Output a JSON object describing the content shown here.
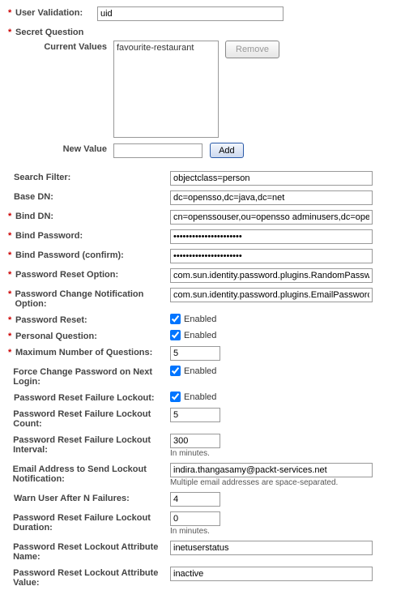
{
  "userValidation": {
    "label": "User Validation:",
    "value": "uid"
  },
  "secretQuestion": {
    "heading": "Secret Question",
    "currentValuesLabel": "Current Values",
    "currentValue": "favourite-restaurant",
    "removeLabel": "Remove",
    "newValueLabel": "New Value",
    "newValue": "",
    "addLabel": "Add"
  },
  "fields": {
    "searchFilter": {
      "label": "Search Filter:",
      "value": "objectclass=person",
      "req": false
    },
    "baseDN": {
      "label": "Base DN:",
      "value": "dc=opensso,dc=java,dc=net",
      "req": false
    },
    "bindDN": {
      "label": "Bind DN:",
      "value": "cn=openssouser,ou=opensso adminusers,dc=opensso,dc=java,dc=net",
      "req": true
    },
    "bindPassword": {
      "label": "Bind Password:",
      "value": "••••••••••••••••••••••",
      "req": true
    },
    "bindPasswordC": {
      "label": "Bind Password (confirm):",
      "value": "••••••••••••••••••••••",
      "req": true
    },
    "pwResetOpt": {
      "label": "Password Reset Option:",
      "value": "com.sun.identity.password.plugins.RandomPasswordGenerator",
      "req": true
    },
    "pwChangeNotif": {
      "label": "Password Change Notification Option:",
      "value": "com.sun.identity.password.plugins.EmailPassword",
      "req": true
    },
    "pwReset": {
      "label": "Password Reset:",
      "checked": true,
      "chkLabel": "Enabled",
      "req": true
    },
    "personalQ": {
      "label": "Personal Question:",
      "checked": true,
      "chkLabel": "Enabled",
      "req": true
    },
    "maxQ": {
      "label": "Maximum Number of Questions:",
      "value": "5",
      "req": true
    },
    "forceChange": {
      "label": "Force Change Password on Next Login:",
      "checked": true,
      "chkLabel": "Enabled",
      "req": false
    },
    "failLockout": {
      "label": "Password Reset Failure Lockout:",
      "checked": true,
      "chkLabel": "Enabled",
      "req": false
    },
    "failCount": {
      "label": "Password Reset Failure Lockout Count:",
      "value": "5",
      "req": false
    },
    "failInterval": {
      "label": "Password Reset Failure Lockout Interval:",
      "value": "300",
      "hint": "In minutes.",
      "req": false
    },
    "lockEmail": {
      "label": "Email Address to Send Lockout Notification:",
      "value": "indira.thangasamy@packt-services.net",
      "hint": "Multiple email addresses are space-separated.",
      "req": false
    },
    "warnAfterN": {
      "label": "Warn User After N Failures:",
      "value": "4",
      "req": false
    },
    "failDuration": {
      "label": "Password Reset Failure Lockout Duration:",
      "value": "0",
      "hint": "In minutes.",
      "req": false
    },
    "lockAttrName": {
      "label": "Password Reset Lockout Attribute Name:",
      "value": "inetuserstatus",
      "req": false
    },
    "lockAttrValue": {
      "label": "Password Reset Lockout Attribute Value:",
      "value": "inactive",
      "req": false
    }
  }
}
